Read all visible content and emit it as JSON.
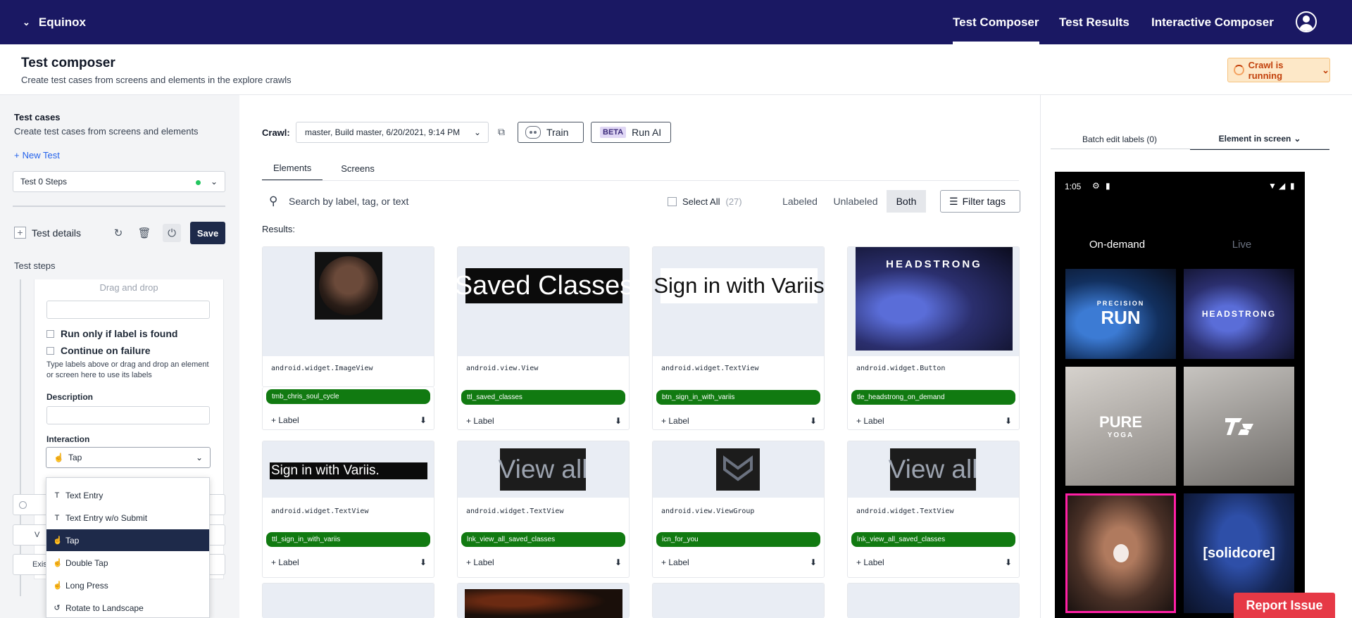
{
  "app": {
    "name": "Equinox"
  },
  "nav": {
    "items": [
      "Test Composer",
      "Test Results",
      "Interactive Composer"
    ],
    "active": "Test Composer"
  },
  "page": {
    "title": "Test composer",
    "subtitle": "Create test cases from screens and elements in the explore crawls",
    "crawl_status": "Crawl is running"
  },
  "left": {
    "title": "Test cases",
    "subtitle": "Create test cases from screens and elements",
    "new_test": "New Test",
    "test_select": "Test 0 Steps",
    "test_details": "Test details",
    "save": "Save",
    "test_steps": "Test steps",
    "step": {
      "drag_drop": "Drag and drop",
      "run_only": "Run only if label is found",
      "continue_failure": "Continue on failure",
      "help": "Type labels above or drag and drop an element or screen here to use its labels",
      "description_label": "Description",
      "interaction_label": "Interaction",
      "interaction_value": "Tap"
    },
    "behind_rows": [
      "V",
      "Exis"
    ],
    "dropdown": [
      {
        "label": "Text Entry",
        "icon": "text-icon",
        "selected": false
      },
      {
        "label": "Text Entry w/o Submit",
        "icon": "text-icon",
        "selected": false
      },
      {
        "label": "Tap",
        "icon": "tap-icon",
        "selected": true
      },
      {
        "label": "Double Tap",
        "icon": "tap-icon",
        "selected": false
      },
      {
        "label": "Long Press",
        "icon": "tap-icon",
        "selected": false
      },
      {
        "label": "Rotate to Landscape",
        "icon": "rotate-icon",
        "selected": false
      }
    ]
  },
  "center": {
    "crawl_label": "Crawl:",
    "crawl_value": "master, Build master, 6/20/2021, 9:14 PM",
    "train": "Train",
    "beta": "BETA",
    "run_ai": "Run AI",
    "tabs": [
      "Elements",
      "Screens"
    ],
    "search_placeholder": "Search by label, tag, or text",
    "select_all": "Select All",
    "select_count": "(27)",
    "filters": [
      "Labeled",
      "Unlabeled",
      "Both"
    ],
    "filter_tags": "Filter tags",
    "results_label": "Results:",
    "add_label": "+ Label",
    "cards": [
      {
        "cls": "android.widget.ImageView",
        "tag": "tmb_chris_soul_cycle",
        "thumb": "portrait"
      },
      {
        "cls": "android.view.View",
        "tag": "ttl_saved_classes",
        "thumb_text": "Saved Classes",
        "thumb": "dark-text"
      },
      {
        "cls": "android.widget.TextView",
        "tag": "btn_sign_in_with_variis",
        "thumb_text": "Sign in with Variis",
        "thumb": "light-text"
      },
      {
        "cls": "android.widget.Button",
        "tag": "tle_headstrong_on_demand",
        "thumb_text": "HEADSTRONG",
        "thumb": "photo"
      },
      {
        "cls": "android.widget.TextView",
        "tag": "ttl_sign_in_with_variis",
        "thumb_text": "Sign in with Variis.",
        "thumb": "dark-text"
      },
      {
        "cls": "android.widget.TextView",
        "tag": "lnk_view_all_saved_classes",
        "thumb_text": "View all",
        "thumb": "dark-text"
      },
      {
        "cls": "android.view.ViewGroup",
        "tag": "icn_for_you",
        "thumb": "icon"
      },
      {
        "cls": "android.widget.TextView",
        "tag": "lnk_view_all_saved_classes",
        "thumb_text": "View all",
        "thumb": "dark-text"
      }
    ]
  },
  "right": {
    "tabs": [
      "Batch edit labels (0)",
      "Element in screen"
    ],
    "phone": {
      "time": "1:05",
      "tabs": [
        "On-demand",
        "Live"
      ],
      "tiles": [
        "RUN",
        "HEADSTRONG",
        "PURE",
        "",
        "",
        "[solidcore]"
      ],
      "tile_top_text": "PRECISION",
      "tile_sub_text": "YOGA"
    }
  },
  "report_issue": "Report Issue",
  "colors": {
    "nav": "#1a1863",
    "tag": "#117a11",
    "save": "#1e2a4a",
    "report": "#e63946",
    "highlight": "#ff1fa5"
  }
}
